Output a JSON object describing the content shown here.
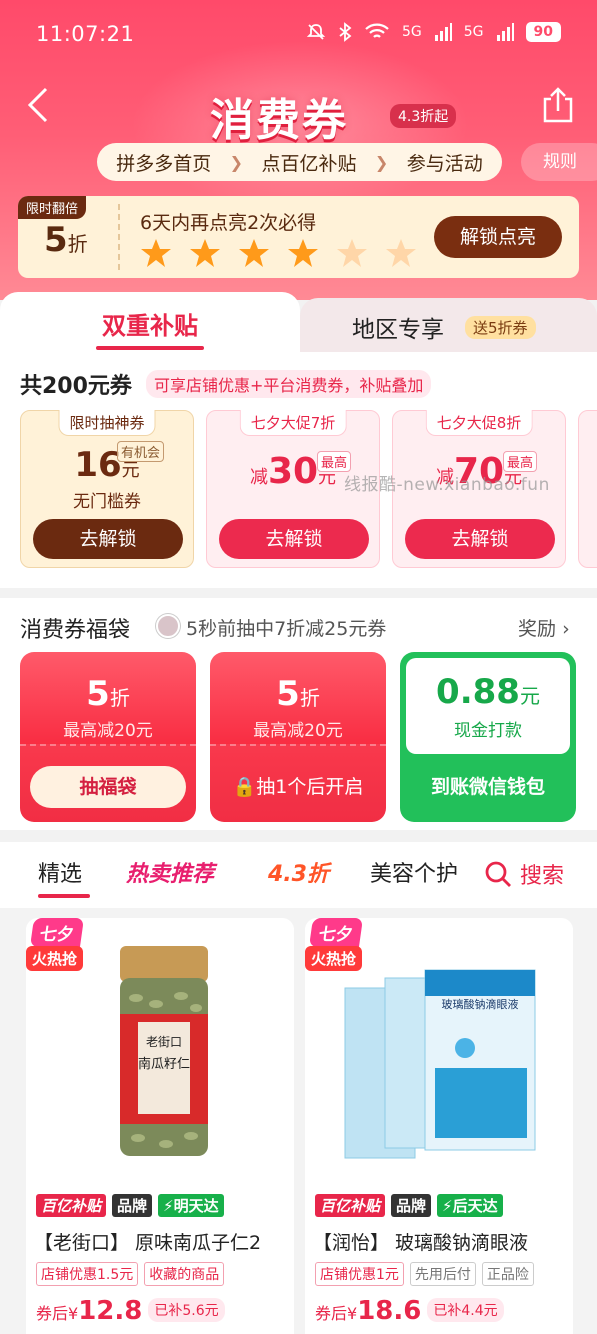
{
  "status_bar": {
    "time": "11:07:21",
    "signal1": "5G",
    "signal2": "5G",
    "battery": "90"
  },
  "header": {
    "title": "消费券",
    "title_tag": "4.3折起",
    "steps": [
      "拼多多首页",
      "点百亿补贴",
      "参与活动"
    ],
    "rules": "规则"
  },
  "unlock": {
    "tag": "限时翻倍",
    "rate": "5",
    "rate_unit": "折",
    "text": "6天内再点亮2次必得",
    "stars_lit": 4,
    "stars_total": 6,
    "button": "解锁点亮"
  },
  "tabs": {
    "active": "双重补贴",
    "other": "地区专享",
    "other_badge": "送5折券"
  },
  "coupons": {
    "heading": "共200元券",
    "tag": "可享店铺优惠+平台消费券，补贴叠加",
    "items": [
      {
        "top": "限时抽神券",
        "amount": "16",
        "unit": "元",
        "chance": "有机会",
        "sub": "无门槛券",
        "button": "去解锁"
      },
      {
        "top": "七夕大促7折",
        "pre": "减",
        "amount": "30",
        "unit": "元",
        "highest": "最高",
        "button": "去解锁"
      },
      {
        "top": "七夕大促8折",
        "pre": "减",
        "amount": "70",
        "unit": "元",
        "highest": "最高",
        "button": "去解锁"
      }
    ],
    "watermark": "线报酷-new.xianbao.fun"
  },
  "lucky_bag": {
    "heading": "消费券福袋",
    "news": "5秒前抽中7折减25元券",
    "reward": "奖励",
    "bags": [
      {
        "rate": "5",
        "unit": "折",
        "sub": "最高减20元",
        "button": "抽福袋"
      },
      {
        "rate": "5",
        "unit": "折",
        "sub": "最高减20元",
        "button": "抽1个后开启"
      },
      {
        "rate": "0.88",
        "unit": "元",
        "sub": "现金打款",
        "button": "到账微信钱包"
      }
    ]
  },
  "feed": {
    "tabs": [
      "精选",
      "热卖推荐",
      "4.3折",
      "美容个护"
    ],
    "search": "搜索",
    "badge_top": "七夕",
    "badge_bottom": "火热抢",
    "products": [
      {
        "tags": [
          "百亿补贴",
          "品牌",
          "明天达"
        ],
        "name": "【老街口】 原味南瓜子仁2",
        "promos": [
          "店铺优惠1.5元",
          "收藏的商品"
        ],
        "price_label": "券后",
        "currency": "¥",
        "price": "12.8",
        "subsidy": "已补5.6元"
      },
      {
        "tags": [
          "百亿补贴",
          "品牌",
          "后天达"
        ],
        "name": "【润怡】 玻璃酸钠滴眼液",
        "promos": [
          "店铺优惠1元",
          "先用后付",
          "正品险"
        ],
        "price_label": "券后",
        "currency": "¥",
        "price": "18.6",
        "subsidy": "已补4.4元"
      }
    ]
  },
  "colors": {
    "primary": "#e8264a",
    "header": "#ff4a6a",
    "gold": "#6b2a10",
    "green": "#22c05a"
  }
}
